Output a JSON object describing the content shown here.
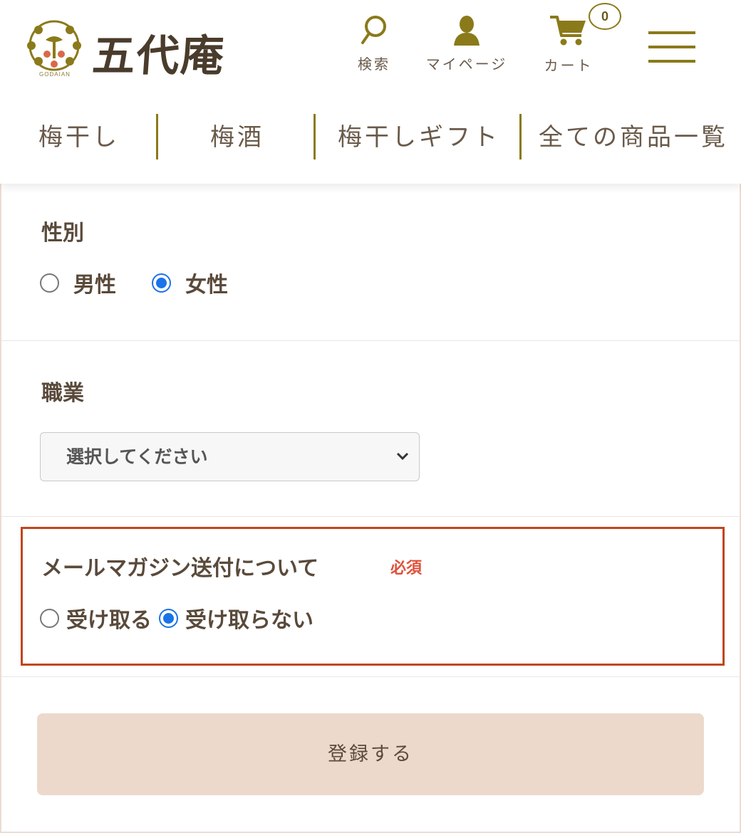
{
  "header": {
    "logo_text": "五代庵",
    "logo_subtext": "GODAIAN",
    "icons": {
      "search": {
        "label": "検索",
        "icon": "search-icon"
      },
      "mypage": {
        "label": "マイページ",
        "icon": "user-icon"
      },
      "cart": {
        "label": "カート",
        "icon": "cart-icon",
        "count": "0"
      }
    },
    "menu_icon": "hamburger-menu-icon",
    "accent_color": "#8a7a1a"
  },
  "nav": {
    "items": [
      {
        "label": "梅干し"
      },
      {
        "label": "梅酒"
      },
      {
        "label": "梅干しギフト"
      },
      {
        "label": "全ての商品一覧"
      }
    ]
  },
  "form": {
    "gender": {
      "label": "性別",
      "options": [
        {
          "label": "男性",
          "checked": false
        },
        {
          "label": "女性",
          "checked": true
        }
      ]
    },
    "occupation": {
      "label": "職業",
      "selected": "選択してください"
    },
    "mail_magazine": {
      "label": "メールマガジン送付について",
      "required": "必須",
      "options": [
        {
          "label": "受け取る",
          "checked": false
        },
        {
          "label": "受け取らない",
          "checked": true
        }
      ],
      "highlight_color": "#c0461e"
    },
    "submit_label": "登録する",
    "radio_checked_color": "#1a73e8",
    "required_color": "#e0503a"
  }
}
